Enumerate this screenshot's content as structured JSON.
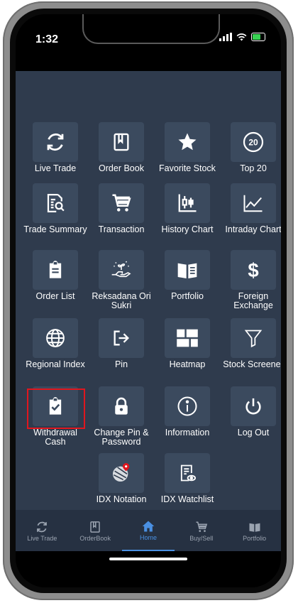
{
  "status": {
    "time": "1:32"
  },
  "menu": [
    {
      "label": "Live Trade",
      "icon": "refresh-icon"
    },
    {
      "label": "Order Book",
      "icon": "book-icon"
    },
    {
      "label": "Favorite Stock",
      "icon": "star-icon"
    },
    {
      "label": "Top 20",
      "icon": "top20-icon"
    },
    {
      "label": "Trade Summary",
      "icon": "document-search-icon"
    },
    {
      "label": "Transaction",
      "icon": "cart-icon"
    },
    {
      "label": "History Chart",
      "icon": "candlestick-icon"
    },
    {
      "label": "Intraday Chart",
      "icon": "line-chart-icon"
    },
    {
      "label": "Order List",
      "icon": "clipboard-icon"
    },
    {
      "label": "Reksadana Ori Sukri",
      "icon": "hand-plant-icon"
    },
    {
      "label": "Portfolio",
      "icon": "open-book-icon"
    },
    {
      "label": "Foreign Exchange",
      "icon": "dollar-icon"
    },
    {
      "label": "Regional Index",
      "icon": "globe-icon"
    },
    {
      "label": "Pin",
      "icon": "logout-arrow-icon"
    },
    {
      "label": "Heatmap",
      "icon": "heatmap-icon"
    },
    {
      "label": "Stock Screener",
      "icon": "filter-icon"
    },
    {
      "label": "Withdrawal Cash",
      "icon": "clipboard-check-icon"
    },
    {
      "label": "Change Pin & Password",
      "icon": "lock-icon"
    },
    {
      "label": "Information",
      "icon": "info-icon"
    },
    {
      "label": "Log Out",
      "icon": "power-icon"
    },
    {
      "label": "IDX Notation",
      "icon": "map-pin-icon"
    },
    {
      "label": "IDX Watchlist",
      "icon": "watchlist-icon"
    }
  ],
  "nav": [
    {
      "label": "Live Trade",
      "icon": "refresh-icon"
    },
    {
      "label": "OrderBook",
      "icon": "book-icon"
    },
    {
      "label": "Home",
      "icon": "home-icon"
    },
    {
      "label": "Buy/Sell",
      "icon": "cart-icon"
    },
    {
      "label": "Portfolio",
      "icon": "open-book-icon"
    }
  ],
  "colors": {
    "background": "#2f3b4d",
    "tile": "#3b4a5e",
    "nav": "#263142",
    "active": "#4a90e2",
    "highlight": "#e0161e"
  }
}
